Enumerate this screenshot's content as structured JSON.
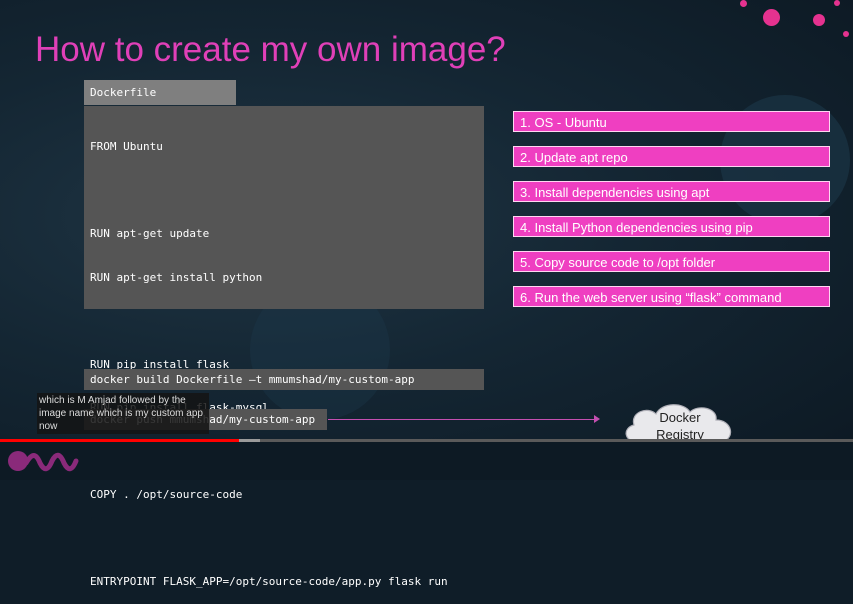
{
  "slide": {
    "title": "How to create my own image?"
  },
  "dockerfile": {
    "tab_label": "Dockerfile",
    "lines": [
      "FROM Ubuntu",
      "",
      "RUN apt-get update",
      "RUN apt-get install python",
      "",
      "RUN pip install flask",
      "RUN pip install flask-mysql",
      "",
      "COPY . /opt/source-code",
      "",
      "ENTRYPOINT FLASK_APP=/opt/source-code/app.py flask run"
    ]
  },
  "steps": [
    "1. OS - Ubuntu",
    "2. Update apt repo",
    "3. Install dependencies using apt",
    "4. Install Python dependencies using pip",
    "5. Copy source code to /opt folder",
    "6. Run the web server using “flask” command"
  ],
  "commands": {
    "build": "docker build Dockerfile –t mmumshad/my-custom-app",
    "push": "docker push mmumshad/my-custom-app"
  },
  "caption": {
    "text": "which is M Amjad followed by the image name which is my custom app now"
  },
  "registry": {
    "label_line1": "Docker",
    "label_line2": "Registry"
  },
  "video": {
    "played_fraction": 0.28,
    "buffered_fraction": 0.305
  },
  "colors": {
    "title": "#e040b8",
    "step_bg": "#ef3fc1",
    "accent_dots": "#e5328f",
    "progress": "#ff0000"
  }
}
